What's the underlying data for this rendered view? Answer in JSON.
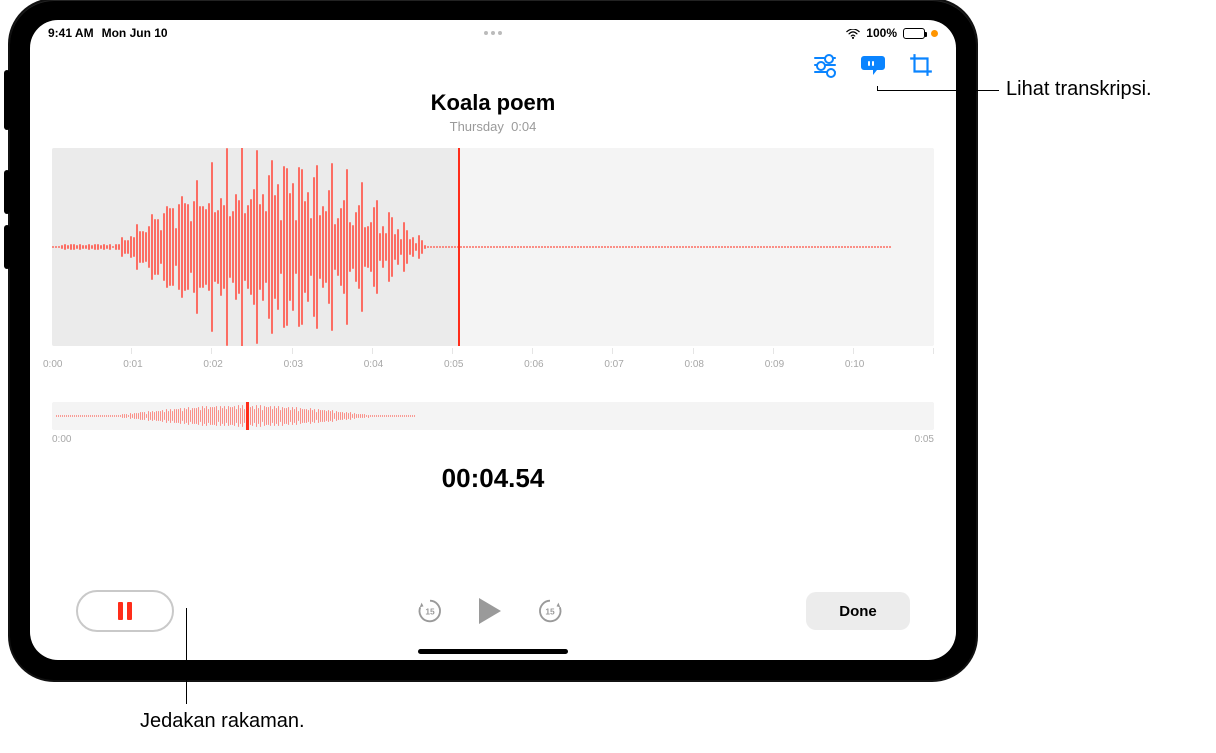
{
  "statusbar": {
    "time": "9:41 AM",
    "date": "Mon Jun 10",
    "battery_pct": "100%"
  },
  "title": {
    "name": "Koala poem",
    "day": "Thursday",
    "duration": "0:04"
  },
  "ruler": {
    "ticks": [
      "0:00",
      "0:01",
      "0:02",
      "0:03",
      "0:04",
      "0:05",
      "0:06",
      "0:07",
      "0:08",
      "0:09",
      "0:10"
    ]
  },
  "mini": {
    "start": "0:00",
    "end": "0:05"
  },
  "timer": "00:04.54",
  "controls": {
    "skip_seconds": "15",
    "done": "Done"
  },
  "callouts": {
    "transcript": "Lihat transkripsi.",
    "pause": "Jedakan rakaman."
  }
}
